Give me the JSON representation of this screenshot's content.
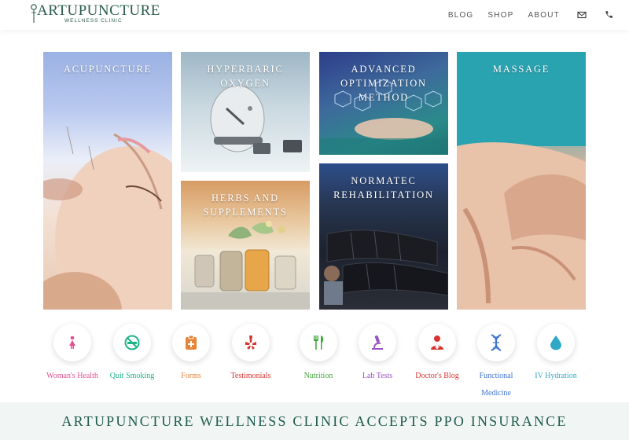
{
  "header": {
    "logo_text": "ARTUPUNCTURE",
    "logo_sub": "WELLNESS CLINIC",
    "nav": [
      "BLOG",
      "SHOP",
      "ABOUT"
    ],
    "icons": [
      "envelope-icon",
      "phone-icon"
    ]
  },
  "tiles": [
    {
      "title": "ACUPUNCTURE"
    },
    {
      "title": "HYPERBARIC OXYGEN"
    },
    {
      "title": "ADVANCED OPTIMIZATION METHOD"
    },
    {
      "title": "MASSAGE"
    },
    {
      "title": "HERBS AND SUPPLEMENTS"
    },
    {
      "title": "NORMATEC REHABILITATION"
    }
  ],
  "services": [
    {
      "label": "Woman's Health",
      "color": "#e0508e",
      "icon": "woman-icon"
    },
    {
      "label": "Quit Smoking",
      "color": "#1fb388",
      "icon": "no-smoking-icon"
    },
    {
      "label": "Forms",
      "color": "#e8843a",
      "icon": "clipboard-icon"
    },
    {
      "label": "Testimonials",
      "color": "#d6322f",
      "icon": "yelp-icon"
    },
    {
      "label": "Nutrition",
      "color": "#3fa93a",
      "icon": "utensils-icon"
    },
    {
      "label": "Lab Tests",
      "color": "#9a52c8",
      "icon": "microscope-icon"
    },
    {
      "label": "Doctor's Blog",
      "color": "#d9342f",
      "icon": "doctor-icon"
    },
    {
      "label": "Functional Medicine",
      "color": "#3f74cf",
      "icon": "dna-icon"
    },
    {
      "label": "IV Hydration",
      "color": "#2fa9c6",
      "icon": "droplet-icon"
    }
  ],
  "banner": {
    "text": "ARTUPUNCTURE WELLNESS CLINIC ACCEPTS PPO INSURANCE"
  }
}
